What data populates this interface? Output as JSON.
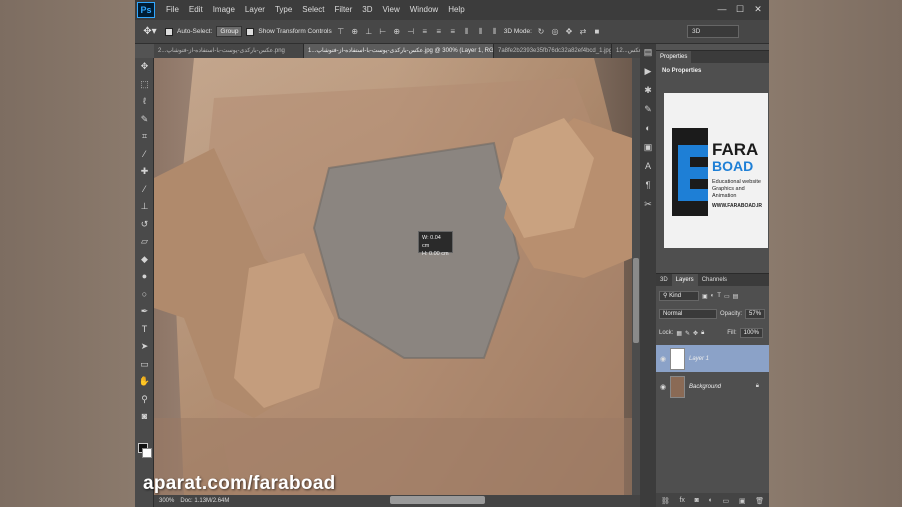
{
  "app": {
    "logo": "Ps"
  },
  "menu": [
    "File",
    "Edit",
    "Image",
    "Layer",
    "Type",
    "Select",
    "Filter",
    "3D",
    "View",
    "Window",
    "Help"
  ],
  "window_controls": [
    "—",
    "☐",
    "✕"
  ],
  "options_bar": {
    "auto_select_label": "Auto-Select:",
    "auto_select_value": "Group",
    "show_transform_label": "Show Transform Controls",
    "mode_3d_label": "3D Mode:",
    "workspace_value": "3D"
  },
  "tabs": [
    {
      "label": "2...عکس-بارکدی-پوست-با-استفاده-از-فتوشاپ.png",
      "active": false
    },
    {
      "label": "1...عکس-بارکدی-پوست-با-استفاده-از-فتوشاپ.jpg @ 300% (Layer 1, RGB/8#) *",
      "active": true
    },
    {
      "label": "7a8fe2b2393e35fb76dc32a82ef4bcd_1.jpg",
      "active": false
    },
    {
      "label": "12...عکس",
      "active": false
    }
  ],
  "status": {
    "zoom": "300%",
    "doc": "Doc: 1.13M/2.64M"
  },
  "readout": {
    "w": "W: 0.04 cm",
    "h": "H: 0.00 cm"
  },
  "properties": {
    "tab": "Properties",
    "empty_label": "No Properties",
    "logo": {
      "brand_top": "FARA",
      "brand_bottom": "BOAD",
      "tagline_1": "Educational website",
      "tagline_2": "Graphics and Animation",
      "url": "WWW.FARABOAD.IR",
      "blue": "#1e7fd6"
    }
  },
  "layers": {
    "tabs": [
      "3D",
      "Layers",
      "Channels"
    ],
    "kind_label": "Kind",
    "blend_mode": "Normal",
    "opacity_label": "Opacity:",
    "opacity_value": "57%",
    "lock_label": "Lock:",
    "fill_label": "Fill:",
    "fill_value": "100%",
    "items": [
      {
        "name": "Layer 1",
        "selected": true
      },
      {
        "name": "Background",
        "selected": false
      }
    ]
  },
  "watermark": "aparat.com/faraboad"
}
